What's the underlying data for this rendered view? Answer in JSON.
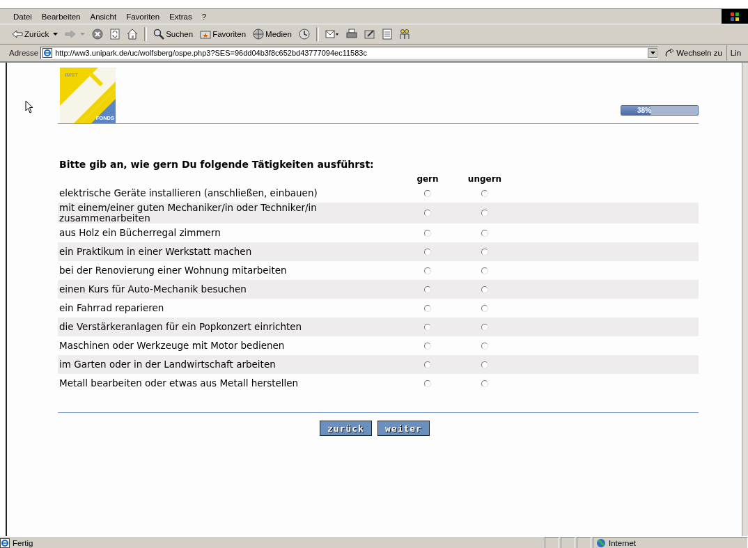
{
  "menu": [
    "Datei",
    "Bearbeiten",
    "Ansicht",
    "Favoriten",
    "Extras",
    "?"
  ],
  "toolbar": [
    {
      "kind": "back",
      "label": "Zurück"
    },
    {
      "kind": "forward"
    },
    {
      "kind": "stop"
    },
    {
      "kind": "refresh"
    },
    {
      "kind": "home"
    },
    {
      "kind": "search",
      "label": "Suchen"
    },
    {
      "kind": "favorites",
      "label": "Favoriten"
    },
    {
      "kind": "media",
      "label": "Medien"
    },
    {
      "kind": "history"
    },
    {
      "kind": "mail"
    },
    {
      "kind": "print"
    },
    {
      "kind": "edit"
    },
    {
      "kind": "discuss"
    },
    {
      "kind": "messenger"
    }
  ],
  "address": {
    "label": "Adresse",
    "value": "http://ww3.unipark.de/uc/wolfsberg/ospe.php3?SES=96dd04b3f8c652bd43777094ec11583c",
    "go": "Wechseln zu",
    "links": "Lin"
  },
  "logo": {
    "top": "IMST",
    "bottom": "FONDS"
  },
  "progress": {
    "level": 0.38,
    "reading": "38%"
  },
  "question": "Bitte gib an, wie gern Du folgende Tätigkeiten ausführst:",
  "columns": [
    "gern",
    "ungern"
  ],
  "items": [
    {
      "text": "elektrische Geräte installieren (anschließen, einbauen)",
      "choices": [
        {
          "selected": false
        },
        {
          "selected": false
        }
      ]
    },
    {
      "text": "mit einem/einer guten Mechaniker/in oder Techniker/in zusammenarbeiten",
      "choices": [
        {
          "selected": false
        },
        {
          "selected": false
        }
      ]
    },
    {
      "text": "aus Holz ein Bücherregal zimmern",
      "choices": [
        {
          "selected": false
        },
        {
          "selected": false
        }
      ]
    },
    {
      "text": "ein Praktikum in einer Werkstatt machen",
      "choices": [
        {
          "selected": false
        },
        {
          "selected": false
        }
      ]
    },
    {
      "text": "bei der Renovierung einer Wohnung mitarbeiten",
      "choices": [
        {
          "selected": false
        },
        {
          "selected": false
        }
      ]
    },
    {
      "text": "einen Kurs für Auto-Mechanik besuchen",
      "choices": [
        {
          "selected": false
        },
        {
          "selected": false
        }
      ]
    },
    {
      "text": "ein Fahrrad reparieren",
      "choices": [
        {
          "selected": false
        },
        {
          "selected": false
        }
      ]
    },
    {
      "text": "die Verstärkeranlagen für ein Popkonzert einrichten",
      "choices": [
        {
          "selected": false
        },
        {
          "selected": false
        }
      ]
    },
    {
      "text": "Maschinen oder Werkzeuge mit Motor bedienen",
      "choices": [
        {
          "selected": false
        },
        {
          "selected": false
        }
      ]
    },
    {
      "text": "im Garten oder in der Landwirtschaft arbeiten",
      "choices": [
        {
          "selected": false
        },
        {
          "selected": false
        }
      ]
    },
    {
      "text": "Metall bearbeiten oder etwas aus Metall herstellen",
      "choices": [
        {
          "selected": false
        },
        {
          "selected": false
        }
      ]
    }
  ],
  "buttons": [
    "zurück",
    "weiter"
  ],
  "status": {
    "text": "Fertig",
    "zone": "Internet"
  }
}
